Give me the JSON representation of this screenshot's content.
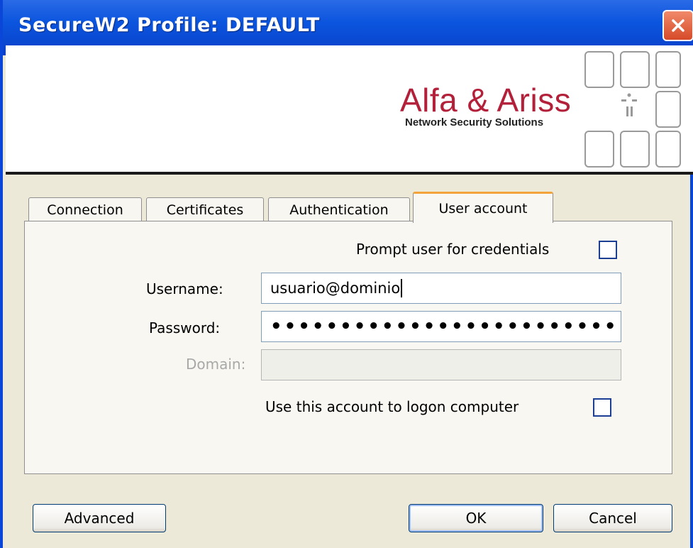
{
  "window": {
    "title": "SecureW2 Profile: DEFAULT"
  },
  "banner": {
    "brand": "Alfa & Ariss",
    "tagline": "Network Security Solutions"
  },
  "tabs": [
    {
      "label": "Connection",
      "active": false
    },
    {
      "label": "Certificates",
      "active": false
    },
    {
      "label": "Authentication",
      "active": false
    },
    {
      "label": "User account",
      "active": true
    }
  ],
  "form": {
    "prompt_label": "Prompt user for credentials",
    "prompt_checked": false,
    "username_label": "Username:",
    "username_value": "usuario@dominio",
    "password_label": "Password:",
    "password_value": "•••••••••••••••••••••••••",
    "domain_label": "Domain:",
    "domain_value": "",
    "logon_label": "Use this account to logon computer",
    "logon_checked": false
  },
  "buttons": {
    "advanced": "Advanced",
    "ok": "OK",
    "cancel": "Cancel"
  },
  "colors": {
    "titlebar": "#0b55de",
    "brand": "#b3203a",
    "tab_highlight": "#f2a33a"
  }
}
